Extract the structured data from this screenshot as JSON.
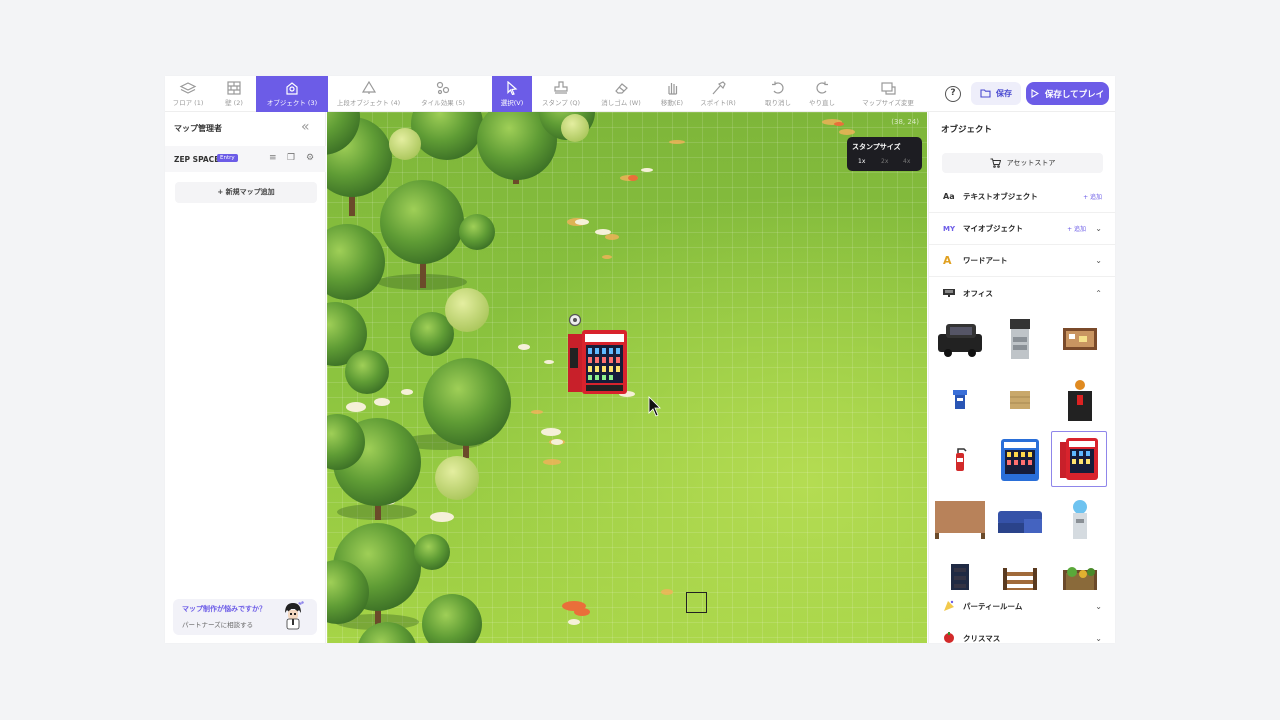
{
  "toolbar": {
    "left_tools": [
      {
        "label": "フロア (1)",
        "icon": "floor-layers-icon"
      },
      {
        "label": "壁 (2)",
        "icon": "wall-icon"
      },
      {
        "label": "オブジェクト (3)",
        "icon": "object-icon",
        "active": true
      },
      {
        "label": "上段オブジェクト (4)",
        "icon": "top-object-icon"
      },
      {
        "label": "タイル効果 (5)",
        "icon": "tile-effect-icon"
      }
    ],
    "right_tools": [
      {
        "label": "選択(V)",
        "icon": "cursor-icon",
        "active": true
      },
      {
        "label": "スタンプ (Q)",
        "icon": "stamp-icon"
      },
      {
        "label": "消しゴム (W)",
        "icon": "eraser-icon"
      },
      {
        "label": "移動(E)",
        "icon": "hand-icon"
      },
      {
        "label": "スポイト(R)",
        "icon": "eyedropper-icon"
      },
      {
        "label": "取り消し",
        "icon": "undo-icon"
      },
      {
        "label": "やり直し",
        "icon": "redo-icon"
      },
      {
        "label": "マップサイズ変更",
        "icon": "resize-icon"
      }
    ],
    "help": "?",
    "save": "保存",
    "save_play": "保存してプレイ"
  },
  "left_sidebar": {
    "title": "マップ管理者",
    "space_name": "ZEP SPACE",
    "space_badge": "Entry",
    "add_map": "+ 新規マップ追加",
    "consult_question": "マップ制作が悩みですか？",
    "consult_sub": "パートナーズに相談する"
  },
  "canvas": {
    "coord": "(38, 24)",
    "stamp_title": "スタンプサイズ",
    "stamp_options": [
      "1x",
      "2x",
      "4x"
    ]
  },
  "right_panel": {
    "title": "オブジェクト",
    "asset_store": "アセットストア",
    "categories": [
      {
        "icon": "Aa",
        "label": "テキストオブジェクト",
        "add": "+ 追加"
      },
      {
        "icon": "MY",
        "label": "マイオブジェクト",
        "add": "+ 追加"
      },
      {
        "icon": "A",
        "label": "ワードアート"
      },
      {
        "icon": "office-icon",
        "label": "オフィス"
      },
      {
        "icon": "party-icon",
        "label": "パーティールーム"
      },
      {
        "icon": "christmas-icon",
        "label": "クリスマス"
      }
    ],
    "objects": [
      "black-car",
      "copy-machine",
      "bulletin-board",
      "trash-bin",
      "box-tile",
      "fire-extinguisher-poster",
      "fire-extinguisher",
      "blue-vending-machine",
      "red-vending-machine",
      "wooden-table",
      "blue-sofa",
      "water-dispenser",
      "dark-cabinet",
      "wooden-fence",
      "plant-shelf"
    ]
  },
  "colors": {
    "accent": "#6c5ce7",
    "grass": "#8cc43f"
  }
}
